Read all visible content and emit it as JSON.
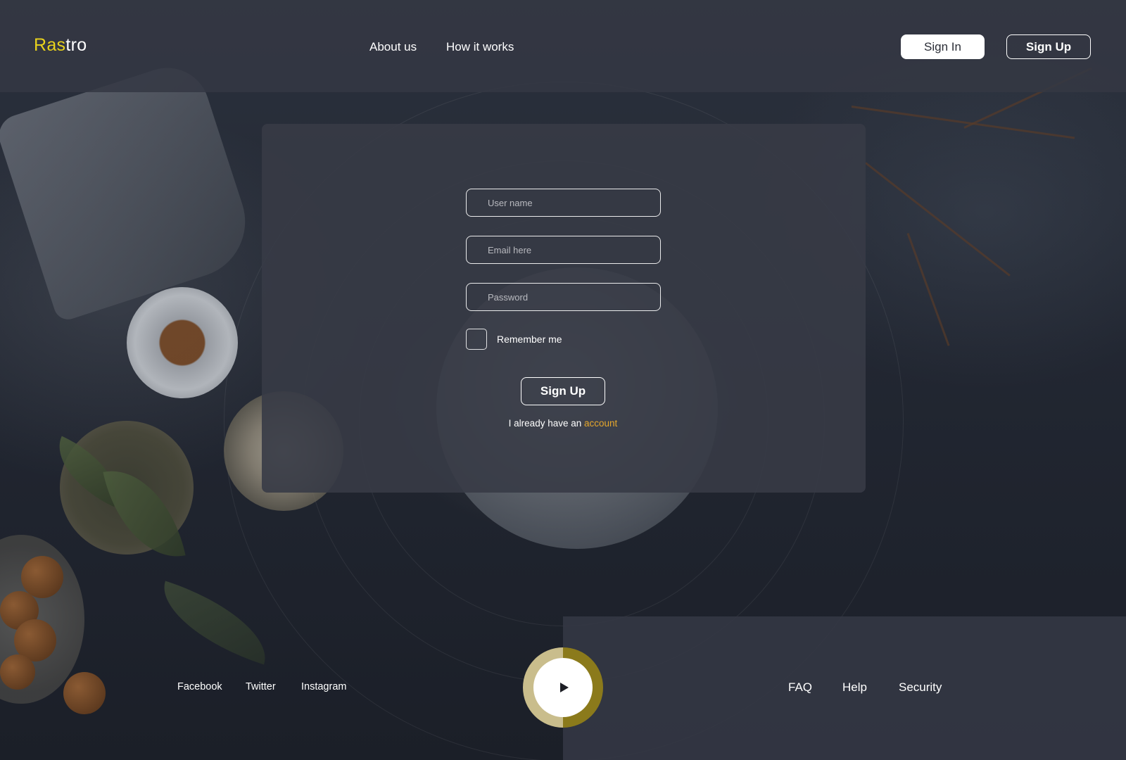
{
  "header": {
    "logo_accent": "Ras",
    "logo_rest": "tro",
    "nav": [
      "About us",
      "How it works"
    ],
    "sign_in_label": "Sign In",
    "sign_up_label": "Sign Up"
  },
  "form": {
    "username_placeholder": "User name",
    "email_placeholder": "Email here",
    "password_placeholder": "Password",
    "remember_label": "Remember me",
    "submit_label": "Sign Up",
    "account_prefix": "I already have an",
    "account_link": "account"
  },
  "footer": {
    "social": [
      "Facebook",
      "Twitter",
      "Instagram"
    ],
    "links": [
      "FAQ",
      "Help",
      "Security"
    ],
    "play_icon": "play-icon"
  },
  "colors": {
    "logo_accent": "#e8d21c",
    "link_accent": "#e6a72c",
    "play_ring_light": "#c9bd8c",
    "play_ring_dark": "#8b7a1b"
  }
}
